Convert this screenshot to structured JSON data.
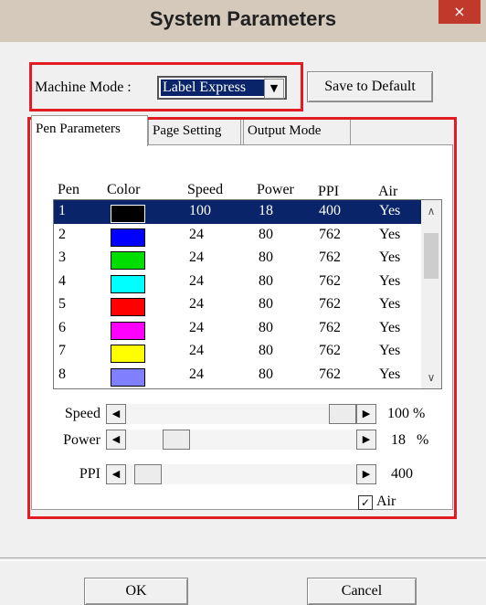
{
  "window": {
    "title": "System Parameters",
    "close_glyph": "×"
  },
  "machine": {
    "label": "Machine Mode :",
    "value": "Label Express",
    "arrow": "▼",
    "save_button": "Save to Default"
  },
  "tabs": [
    {
      "label": "Pen Parameters",
      "active": true
    },
    {
      "label": "Page Setting",
      "active": false
    },
    {
      "label": "Output Mode",
      "active": false
    }
  ],
  "columns": [
    "Pen",
    "Color",
    "Speed",
    "Power",
    "PPI",
    "Air"
  ],
  "rows": [
    {
      "pen": "1",
      "color": "#000000",
      "speed": "100",
      "power": "18",
      "ppi": "400",
      "air": "Yes",
      "selected": true
    },
    {
      "pen": "2",
      "color": "#0000ff",
      "speed": "24",
      "power": "80",
      "ppi": "762",
      "air": "Yes",
      "selected": false
    },
    {
      "pen": "3",
      "color": "#00dd00",
      "speed": "24",
      "power": "80",
      "ppi": "762",
      "air": "Yes",
      "selected": false
    },
    {
      "pen": "4",
      "color": "#00ffff",
      "speed": "24",
      "power": "80",
      "ppi": "762",
      "air": "Yes",
      "selected": false
    },
    {
      "pen": "5",
      "color": "#ff0000",
      "speed": "24",
      "power": "80",
      "ppi": "762",
      "air": "Yes",
      "selected": false
    },
    {
      "pen": "6",
      "color": "#ff00ff",
      "speed": "24",
      "power": "80",
      "ppi": "762",
      "air": "Yes",
      "selected": false
    },
    {
      "pen": "7",
      "color": "#ffff00",
      "speed": "24",
      "power": "80",
      "ppi": "762",
      "air": "Yes",
      "selected": false
    },
    {
      "pen": "8",
      "color": "#8080ff",
      "speed": "24",
      "power": "80",
      "ppi": "762",
      "air": "Yes",
      "selected": false
    }
  ],
  "sliders": {
    "speed": {
      "label": "Speed",
      "value": "100",
      "unit": "%",
      "level": 1.0
    },
    "power": {
      "label": "Power",
      "value": "18",
      "unit": "%",
      "level": 0.18
    },
    "ppi": {
      "label": "PPI",
      "value": "400",
      "unit": "",
      "level": 0.04
    }
  },
  "scroll_glyphs": {
    "left": "◀",
    "right": "▶",
    "up": "∧",
    "down": "∨"
  },
  "air": {
    "label": "Air",
    "checked": true,
    "check_glyph": "✓"
  },
  "buttons": {
    "ok": "OK",
    "cancel": "Cancel"
  },
  "colors": {
    "selection": "#0a246a",
    "highlight_box": "#e31b23"
  }
}
